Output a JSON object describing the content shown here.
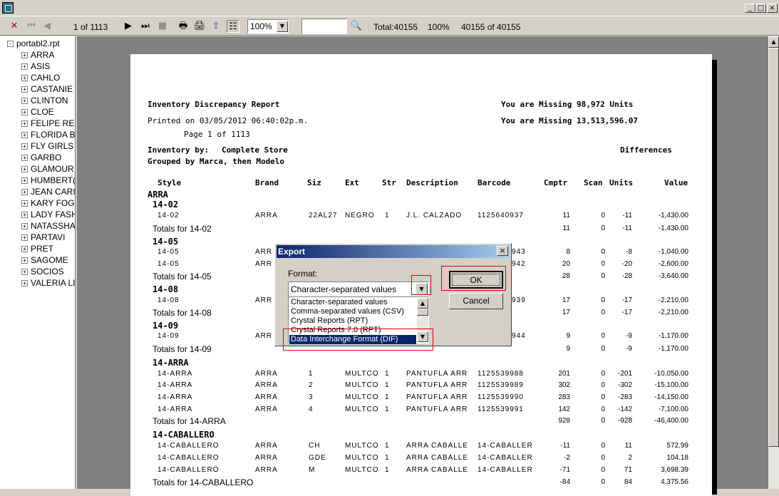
{
  "window": {
    "minimize": "_",
    "maximize": "□",
    "close": "×"
  },
  "toolbar": {
    "page_indicator": "1 of 1113",
    "zoom": "100%",
    "search_value": "",
    "total": "Total:40155",
    "percent": "100%",
    "records": "40155 of 40155"
  },
  "tree": {
    "root": "portabl2.rpt",
    "items": [
      "ARRA",
      "ASIS",
      "CAHLO",
      "CASTANIE",
      "CLINTON",
      "CLOE",
      "FELIPE REI",
      "FLORIDA B",
      "FLY GIRLS",
      "GARBO",
      "GLAMOUR",
      "HUMBERT(",
      "JEAN CARI",
      "KARY FOG(",
      "LADY FASH",
      "NATASSHA",
      "PARTAVI",
      "PRET",
      "SAGOME",
      "SOCIOS",
      "VALERIA LI"
    ]
  },
  "report": {
    "title": "Inventory Discrepancy Report",
    "printed": "Printed on 03/05/2012  06:40:02p.m.",
    "page": "Page 1 of 1113",
    "missing_units": "You are Missing 98,972 Units",
    "missing_value": "You are Missing 13,513,596.07",
    "inventory_by_label": "Inventory by:",
    "inventory_by_value": "Complete Store",
    "grouped_by": "Grouped by Marca, then Modelo",
    "differences": "Differences",
    "headers": {
      "style": "Style",
      "brand": "Brand",
      "siz": "Siz",
      "ext": "Ext",
      "str": "Str",
      "description": "Description",
      "barcode": "Barcode",
      "cmptr": "Cmptr",
      "scan": "Scan",
      "units": "Units",
      "value": "Value"
    },
    "group": "ARRA",
    "lines": {
      "g1": "14-02",
      "r1": [
        "14-02",
        "ARRA",
        "22AL27",
        "NEGRO",
        "1",
        "J.L. CALZADO",
        "1125640937",
        "11",
        "0",
        "-11",
        "-1,430.00"
      ],
      "t1": [
        "Totals for 14-02",
        "11",
        "0",
        "-11",
        "-1,430.00"
      ],
      "g2": "14-05",
      "r2a": [
        "14-05",
        "ARR",
        "943",
        "8",
        "0",
        "-8",
        "-1,040.00"
      ],
      "r2b": [
        "14-05",
        "ARR",
        "942",
        "20",
        "0",
        "-20",
        "-2,600.00"
      ],
      "t2": [
        "Totals for 14-05",
        "28",
        "0",
        "-28",
        "-3,640.00"
      ],
      "g3": "14-08",
      "r3": [
        "14-08",
        "ARR",
        "939",
        "17",
        "0",
        "-17",
        "-2,210.00"
      ],
      "t3": [
        "Totals for 14-08",
        "17",
        "0",
        "-17",
        "-2,210.00"
      ],
      "g4": "14-09",
      "r4": [
        "14-09",
        "ARR",
        "944",
        "9",
        "0",
        "-9",
        "-1,170.00"
      ],
      "t4": [
        "Totals for 14-09",
        "9",
        "0",
        "-9",
        "-1,170.00"
      ],
      "g5": "14-ARRA",
      "r5a": [
        "14-ARRA",
        "ARRA",
        "1",
        "MULTCO",
        "1",
        "PANTUFLA ARR",
        "1125539988",
        "201",
        "0",
        "-201",
        "-10,050.00"
      ],
      "r5b": [
        "14-ARRA",
        "ARRA",
        "2",
        "MULTCO",
        "1",
        "PANTUFLA ARR",
        "1125539989",
        "302",
        "0",
        "-302",
        "-15,100.00"
      ],
      "r5c": [
        "14-ARRA",
        "ARRA",
        "3",
        "MULTCO",
        "1",
        "PANTUFLA ARR",
        "1125539990",
        "283",
        "0",
        "-283",
        "-14,150.00"
      ],
      "r5d": [
        "14-ARRA",
        "ARRA",
        "4",
        "MULTCO",
        "1",
        "PANTUFLA ARR",
        "1125539991",
        "142",
        "0",
        "-142",
        "-7,100.00"
      ],
      "t5": [
        "Totals for 14-ARRA",
        "928",
        "0",
        "-928",
        "-46,400.00"
      ],
      "g6": "14-CABALLERO",
      "r6a": [
        "14-CABALLERO",
        "ARRA",
        "CH",
        "MULTCO",
        "1",
        "ARRA CABALLE",
        "14-CABALLER",
        "-11",
        "0",
        "11",
        "572.99"
      ],
      "r6b": [
        "14-CABALLERO",
        "ARRA",
        "GDE",
        "MULTCO",
        "1",
        "ARRA CABALLE",
        "14-CABALLER",
        "-2",
        "0",
        "2",
        "104.18"
      ],
      "r6c": [
        "14-CABALLERO",
        "ARRA",
        "M",
        "MULTCO",
        "1",
        "ARRA CABALLE",
        "14-CABALLER",
        "-71",
        "0",
        "71",
        "3,698.39"
      ],
      "t6": [
        "Totals for 14-CABALLERO",
        "-84",
        "0",
        "84",
        "4,375.56"
      ]
    }
  },
  "dialog": {
    "title": "Export",
    "close": "×",
    "format_label": "Format:",
    "selected": "Character-separated values",
    "options": [
      "Character-separated values",
      "Comma-separated values (CSV)",
      "Crystal Reports (RPT)",
      "Crystal Reports 7.0 (RPT)",
      "Data Interchange Format (DIF)"
    ],
    "ok": "OK",
    "cancel": "Cancel"
  },
  "colors": {
    "highlight": "#e00000",
    "selection": "#0a246a",
    "dialog_title": "#0a246a"
  }
}
